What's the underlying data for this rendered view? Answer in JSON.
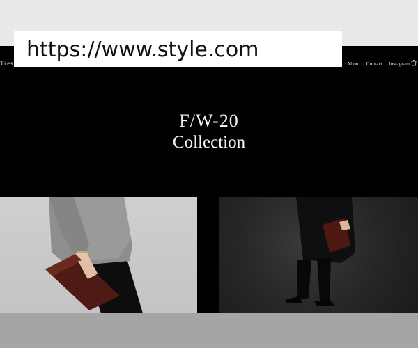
{
  "browser": {
    "url": "https://www.style.com"
  },
  "site": {
    "logo_fragment": "Tres",
    "nav": {
      "about": "About",
      "contact": "Contact",
      "instagram": "Instagram"
    }
  },
  "hero": {
    "line1": "F/W-20",
    "line2": "Collection"
  },
  "tiles": [
    {
      "description_name": "grey-sweater-model-with-clutch"
    },
    {
      "description_name": "black-coat-model-with-clutch"
    }
  ],
  "colors": {
    "background": "#000000",
    "accent_leather": "#5a1f16",
    "text": "#f2f2f2"
  }
}
